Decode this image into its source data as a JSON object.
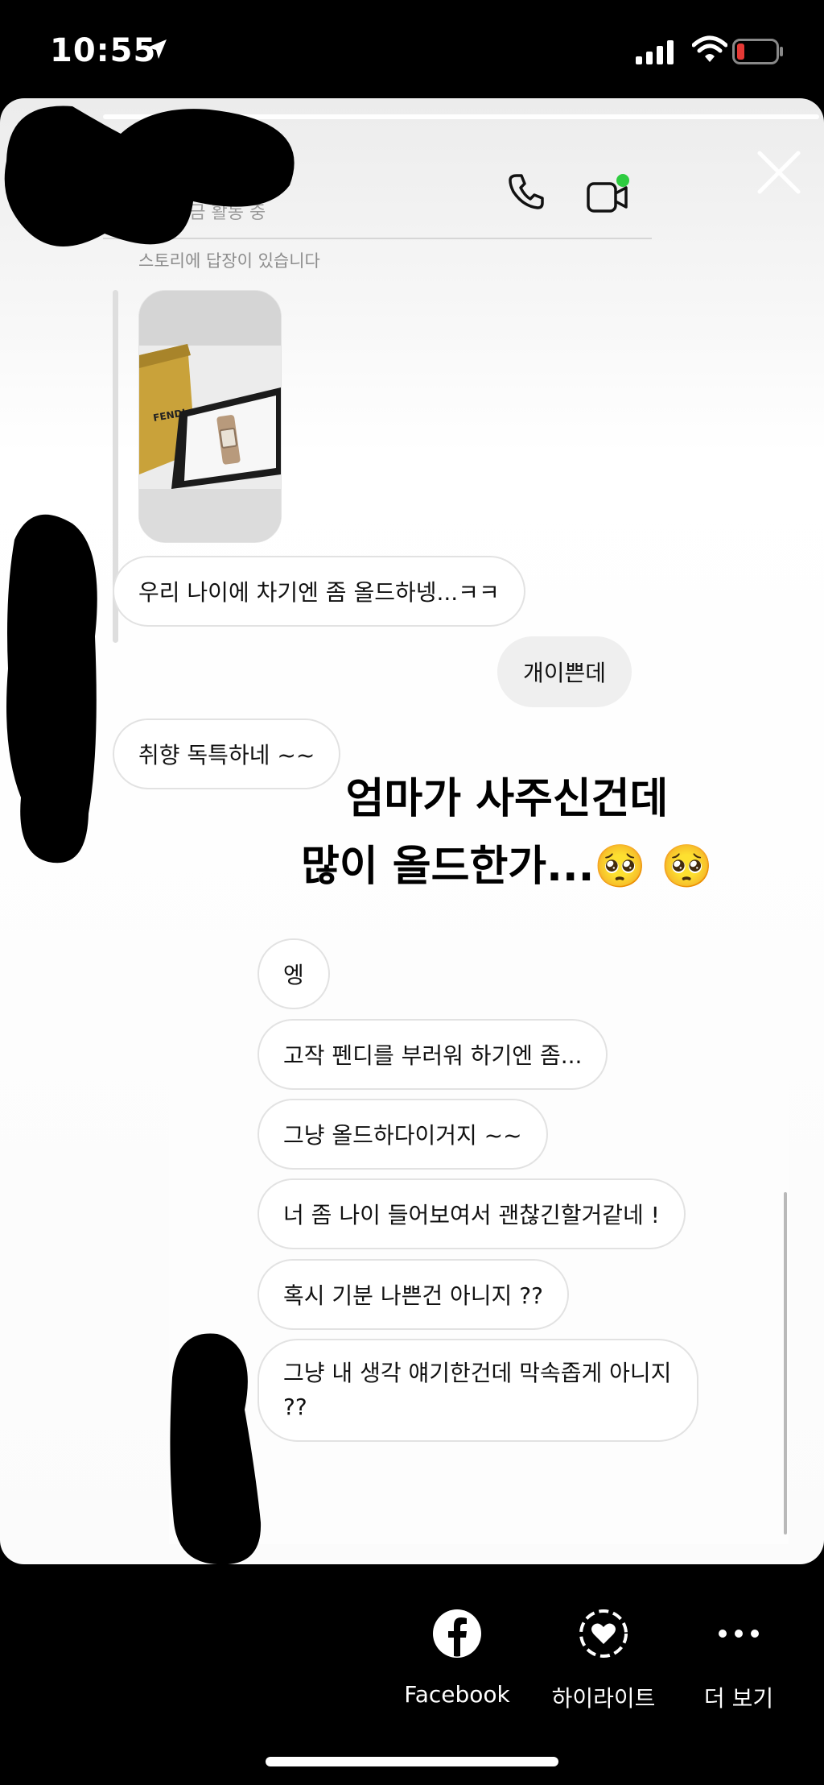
{
  "status": {
    "time": "10:55",
    "icons": [
      "location-arrow-icon",
      "signal-icon",
      "wifi-icon",
      "battery-low-icon"
    ],
    "battery_color": "#e53935"
  },
  "header": {
    "activity": "지금 활동 중",
    "icons": [
      "phone-icon",
      "video-call-icon",
      "close-icon"
    ],
    "online_dot_color": "#2ecc40"
  },
  "thread1": {
    "reply_notice": "스토리에 답장이 있습니다",
    "story_thumb_brand": "FENDI",
    "messages": [
      {
        "side": "them",
        "text": "우리 나이에 차기엔 좀 올드하넹...ㅋㅋ"
      },
      {
        "side": "me",
        "text": "개이쁜데"
      },
      {
        "side": "them",
        "text": "취향 독특하네 ~~"
      }
    ]
  },
  "caption": {
    "line1": "엄마가 사주신건데",
    "line2": "많이 올드한가...🥺 🥺"
  },
  "thread2": {
    "messages": [
      {
        "text": "엥"
      },
      {
        "text": "고작 펜디를 부러워 하기엔 좀..."
      },
      {
        "text": "그냥 올드하다이거지 ~~"
      },
      {
        "text": "너 좀 나이 들어보여서 괜찮긴할거같네 !"
      },
      {
        "text": "혹시 기분 나쁜건 아니지 ??"
      },
      {
        "text": "그냥 내 생각 얘기한건데 막속좁게 아니지 ??"
      }
    ]
  },
  "bottom_actions": [
    {
      "label": "Facebook",
      "icon": "facebook-icon"
    },
    {
      "label": "하이라이트",
      "icon": "highlight-heart-icon"
    },
    {
      "label": "더 보기",
      "icon": "more-dots-icon"
    }
  ]
}
